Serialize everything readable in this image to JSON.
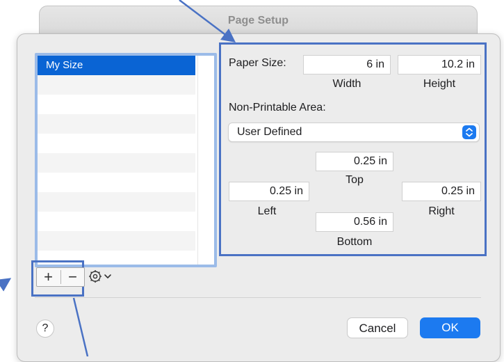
{
  "window": {
    "title": "Page Setup"
  },
  "sizes_list": {
    "items": [
      "My Size",
      "",
      "",
      "",
      "",
      "",
      "",
      "",
      "",
      "",
      ""
    ],
    "selected_index": 0
  },
  "toolbar": {
    "add_label": "+",
    "remove_label": "−",
    "gear_icon": "gear-icon",
    "chevron_icon": "chevron-down-icon"
  },
  "paper_size": {
    "label": "Paper Size:",
    "width_value": "6 in",
    "height_value": "10.2 in",
    "width_caption": "Width",
    "height_caption": "Height"
  },
  "non_printable": {
    "label": "Non-Printable Area:",
    "selected": "User Defined",
    "top_value": "0.25 in",
    "top_caption": "Top",
    "left_value": "0.25 in",
    "left_caption": "Left",
    "right_value": "0.25 in",
    "right_caption": "Right",
    "bottom_value": "0.56 in",
    "bottom_caption": "Bottom"
  },
  "buttons": {
    "help": "?",
    "cancel": "Cancel",
    "ok": "OK"
  },
  "colors": {
    "accent": "#1c7af0",
    "callout": "#4a72c4",
    "selection": "#0a64d4"
  }
}
